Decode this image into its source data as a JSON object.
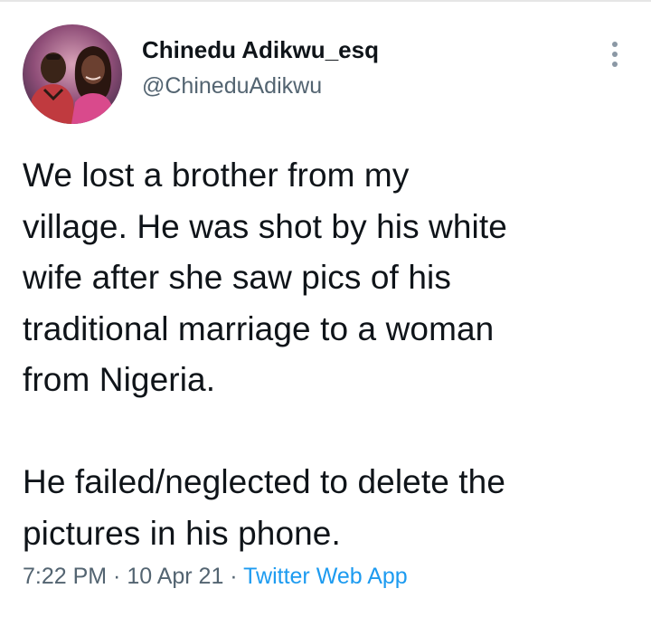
{
  "author": {
    "display_name": "Chinedu Adikwu_esq",
    "handle": "@ChineduAdikwu",
    "avatar_icon": "profile-photo"
  },
  "menu": {
    "icon": "more-vertical-icon"
  },
  "tweet": {
    "paragraph1_lines": [
      "We lost a brother from my",
      "village. He was shot by his white",
      "wife after she saw pics of his",
      "traditional marriage to a woman",
      "from Nigeria."
    ],
    "paragraph2_lines": [
      "He failed/neglected to delete the",
      "pictures in his phone."
    ]
  },
  "meta": {
    "time": "7:22 PM",
    "separator": " · ",
    "date": "10 Apr 21",
    "source": "Twitter Web App"
  },
  "colors": {
    "text_primary": "#0f1419",
    "text_secondary": "#536471",
    "link": "#1d9bf0"
  }
}
